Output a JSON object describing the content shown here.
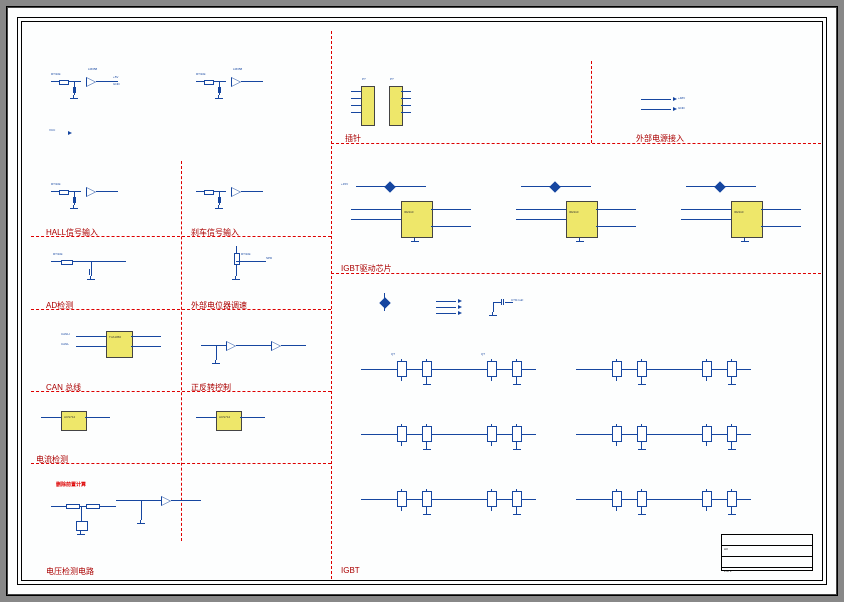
{
  "sections": {
    "hall_input": "HALL信号输入",
    "brake_input": "刹车信号输入",
    "ad_detect": "AD检测",
    "ext_pot": "外部电位器调速",
    "can_bus": "CAN 总线",
    "fwd_rev": "正反转控制",
    "current_detect": "电流检测",
    "voltage_detect": "电压检测电路",
    "connector": "插针",
    "ext_power": "外部电源接入",
    "igbt_driver": "IGBT驱动芯片",
    "igbt": "IGBT"
  },
  "annotations": {
    "sampling_note": "删除前置计算"
  },
  "components": {
    "opamp1": {
      "ref": "U?A",
      "part": "LM358"
    },
    "opamp2": {
      "ref": "U?B",
      "part": "LM358"
    },
    "driver1": {
      "ref": "U?",
      "part": "IR2110"
    },
    "driver2": {
      "ref": "U?",
      "part": "IR2110"
    },
    "driver3": {
      "ref": "U?",
      "part": "IR2110"
    },
    "can_chip": {
      "ref": "U?",
      "part": "TJA1050"
    },
    "curr_chip1": {
      "ref": "U?",
      "part": "ACS712"
    },
    "curr_chip2": {
      "ref": "U?",
      "part": "ACS712"
    },
    "r_generic": "R?/10k",
    "c_generic": "C?/0.1uF",
    "conn1": {
      "ref": "P?",
      "part": "Header-8"
    },
    "conn2": {
      "ref": "P?",
      "part": "Header-8"
    },
    "signal_vcc": "+5V",
    "signal_gnd": "GND"
  },
  "title_block": {
    "title": "",
    "size": "A3",
    "number": "",
    "date": "",
    "sheet": "1 of 1"
  }
}
